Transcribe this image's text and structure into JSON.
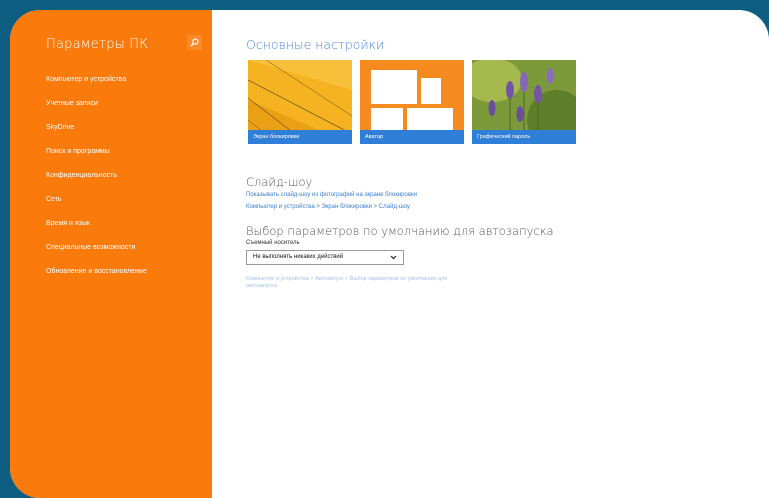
{
  "sidebar": {
    "title": "Параметры ПК",
    "items": [
      {
        "label": "Компьютер и устройства"
      },
      {
        "label": "Учетные записи"
      },
      {
        "label": "SkyDrive"
      },
      {
        "label": "Поиск и программы"
      },
      {
        "label": "Конфиденциальность"
      },
      {
        "label": "Сеть"
      },
      {
        "label": "Время и язык"
      },
      {
        "label": "Специальные возможности"
      },
      {
        "label": "Обновление и восстановление"
      }
    ]
  },
  "main": {
    "heading": "Основные настройки",
    "tiles": [
      {
        "label": "Экран блокировки"
      },
      {
        "label": "Аватар"
      },
      {
        "label": "Графический пароль"
      }
    ],
    "slideshow": {
      "heading": "Слайд-шоу",
      "link": "Показывать слайд-шоу из фотографий на экране блокировки",
      "breadcrumb": "Компьютер и устройства > Экран блокировки > Слайд-шоу"
    },
    "autoplay": {
      "heading": "Выбор параметров по умолчанию для автозапуска",
      "label": "Съемный носитель",
      "value": "Не выполнять никаких действий",
      "breadcrumb_line1": "Компьютер и устройства > Автозапуск > Выбор параметров по умолчанию для",
      "breadcrumb_line2": "автозапуска"
    }
  },
  "icons": {
    "search": "search-icon",
    "dropdown": "chevron-down-icon"
  },
  "colors": {
    "accent": "#fa7a0c",
    "background": "#0d5e80",
    "link": "#3d7fd0"
  }
}
